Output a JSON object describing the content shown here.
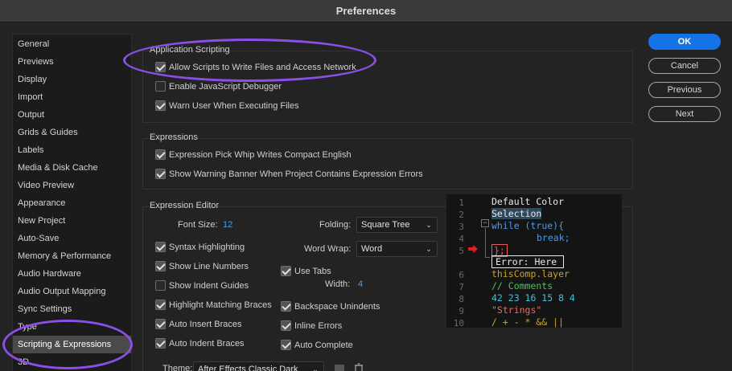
{
  "window": {
    "title": "Preferences"
  },
  "sidebar": {
    "items": [
      {
        "label": "General"
      },
      {
        "label": "Previews"
      },
      {
        "label": "Display"
      },
      {
        "label": "Import"
      },
      {
        "label": "Output"
      },
      {
        "label": "Grids & Guides"
      },
      {
        "label": "Labels"
      },
      {
        "label": "Media & Disk Cache"
      },
      {
        "label": "Video Preview"
      },
      {
        "label": "Appearance"
      },
      {
        "label": "New Project"
      },
      {
        "label": "Auto-Save"
      },
      {
        "label": "Memory & Performance"
      },
      {
        "label": "Audio Hardware"
      },
      {
        "label": "Audio Output Mapping"
      },
      {
        "label": "Sync Settings"
      },
      {
        "label": "Type"
      },
      {
        "label": "Scripting & Expressions",
        "selected": true
      },
      {
        "label": "3D"
      }
    ]
  },
  "buttons": {
    "ok": "OK",
    "cancel": "Cancel",
    "previous": "Previous",
    "next": "Next"
  },
  "app_scripting": {
    "title": "Application Scripting",
    "allow_scripts": {
      "label": "Allow Scripts to Write Files and Access Network",
      "checked": true
    },
    "js_debugger": {
      "label": "Enable JavaScript Debugger",
      "checked": false
    },
    "warn_user": {
      "label": "Warn User When Executing Files",
      "checked": true
    }
  },
  "expressions": {
    "title": "Expressions",
    "pick_whip": {
      "label": "Expression Pick Whip Writes Compact English",
      "checked": true
    },
    "warning_banner": {
      "label": "Show Warning Banner When Project Contains Expression Errors",
      "checked": true
    }
  },
  "editor": {
    "title": "Expression Editor",
    "font_size_label": "Font Size:",
    "font_size_value": "12",
    "folding_label": "Folding:",
    "folding_value": "Square Tree",
    "word_wrap_label": "Word Wrap:",
    "word_wrap_value": "Word",
    "syntax_highlighting": {
      "label": "Syntax Highlighting",
      "checked": true
    },
    "show_line_numbers": {
      "label": "Show Line Numbers",
      "checked": true
    },
    "show_indent_guides": {
      "label": "Show Indent Guides",
      "checked": false
    },
    "highlight_braces": {
      "label": "Highlight Matching Braces",
      "checked": true
    },
    "auto_insert_braces": {
      "label": "Auto Insert Braces",
      "checked": true
    },
    "auto_indent_braces": {
      "label": "Auto Indent Braces",
      "checked": true
    },
    "use_tabs": {
      "label": "Use Tabs",
      "checked": true
    },
    "width_label": "Width:",
    "width_value": "4",
    "backspace_unindents": {
      "label": "Backspace Unindents",
      "checked": true
    },
    "inline_errors": {
      "label": "Inline Errors",
      "checked": true
    },
    "auto_complete": {
      "label": "Auto Complete",
      "checked": true
    },
    "theme_label": "Theme:",
    "theme_value": "After Effects Classic Dark"
  },
  "preview": {
    "line_numbers": [
      "1",
      "2",
      "3",
      "4",
      "5",
      "6",
      "7",
      "8",
      "9",
      "10"
    ],
    "lines": {
      "l1": "Default Color",
      "l2": "Selection",
      "l3_kw": "while",
      "l3_paren": " (true){",
      "l4": "break;",
      "l5": "};",
      "l5_err": "Error: Here",
      "l6": "thisComp.layer",
      "l7": "// Comments",
      "l8": "42 23 16 15 8 4",
      "l9": "\"Strings\"",
      "l10": "/ + - * && ||"
    },
    "colors": {
      "keyword": "#4e9ae8",
      "comment": "#4fbf62",
      "number": "#3fc0e0",
      "string": "#e86a62",
      "operator": "#c9a227",
      "error": "#e35c5c"
    }
  }
}
